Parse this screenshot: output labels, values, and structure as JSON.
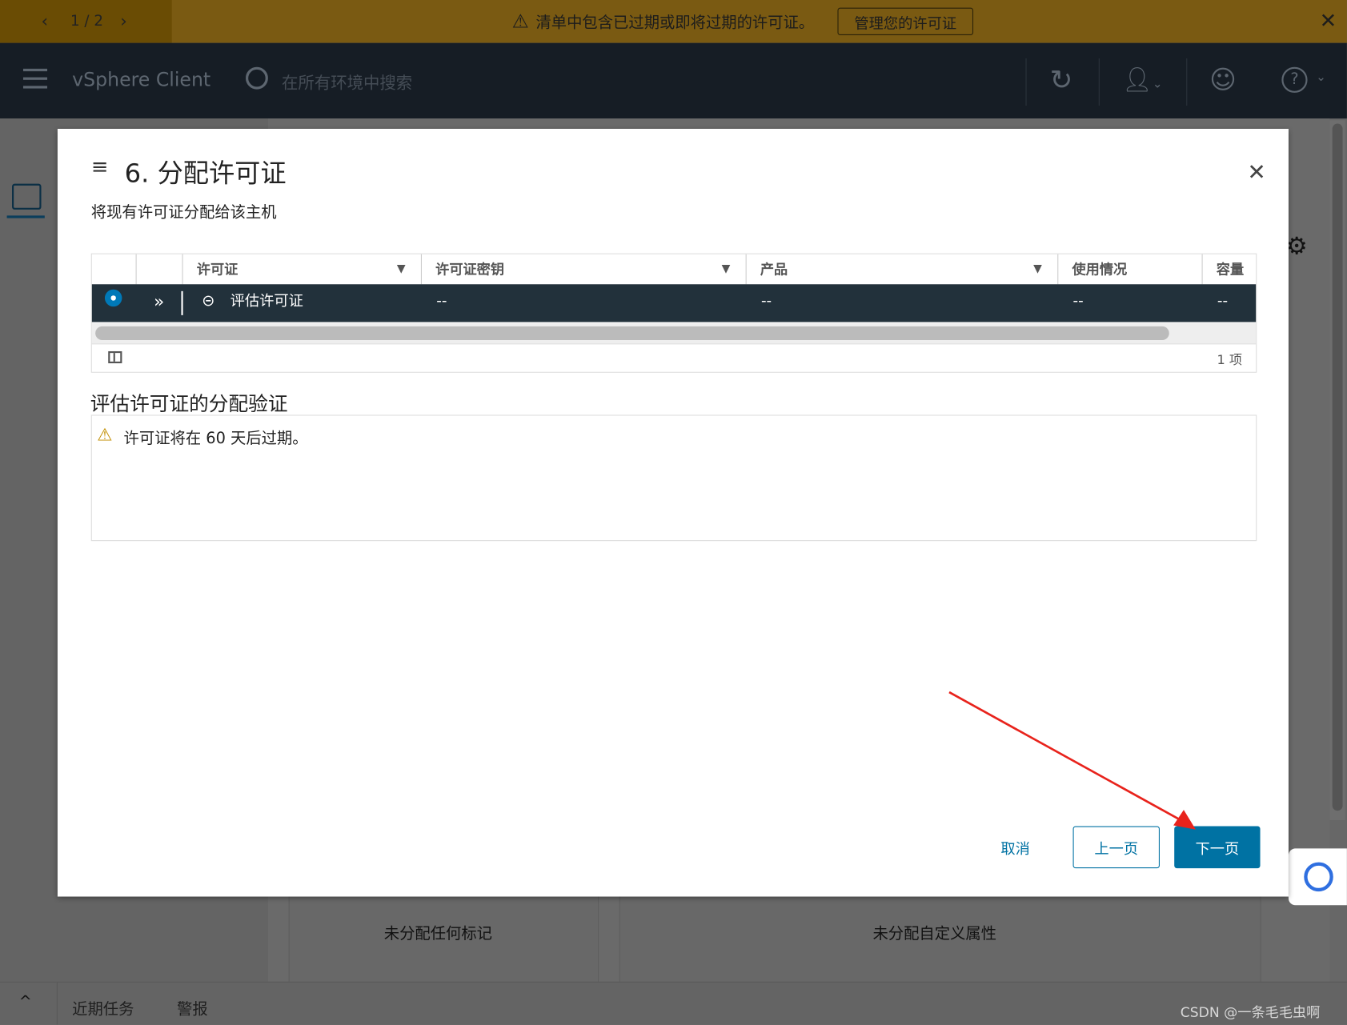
{
  "banner": {
    "pager": "1 / 2",
    "message": "清单中包含已过期或即将过期的许可证。",
    "manage_button": "管理您的许可证"
  },
  "header": {
    "app_title": "vSphere Client",
    "search_placeholder": "在所有环境中搜索"
  },
  "modal": {
    "title": "6. 分配许可证",
    "subtitle": "将现有许可证分配给该主机",
    "grid": {
      "columns": [
        "许可证",
        "许可证密钥",
        "产品",
        "使用情况",
        "容量"
      ],
      "rows": [
        {
          "license": "评估许可证",
          "key": "--",
          "product": "--",
          "usage": "--",
          "capacity": "--"
        }
      ],
      "count": "1 项"
    },
    "validation_title": "评估许可证的分配验证",
    "validation_message": "许可证将在 60 天后过期。",
    "cancel": "取消",
    "back": "上一页",
    "next": "下一页"
  },
  "background": {
    "tags_empty": "未分配任何标记",
    "attrs_empty": "未分配自定义属性"
  },
  "bottom_bar": {
    "recent_tasks": "近期任务",
    "alarms": "警报"
  },
  "watermark": "CSDN @一条毛毛虫啊",
  "colors": {
    "primary": "#0072a3",
    "selected_row": "#22313b",
    "warning": "#c28e00",
    "arrow": "#e8231c"
  }
}
